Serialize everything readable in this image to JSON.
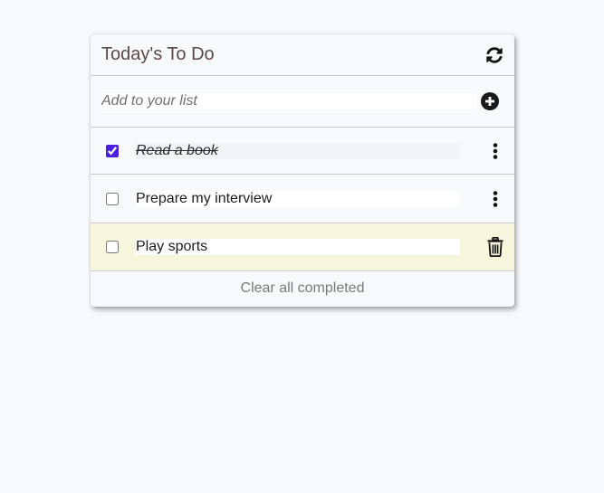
{
  "header": {
    "title": "Today's To Do",
    "refresh_icon": "refresh-icon"
  },
  "add": {
    "placeholder": "Add to your list",
    "value": "",
    "add_icon": "plus-circle-icon"
  },
  "items": [
    {
      "text": "Read a book",
      "completed": true,
      "action_icon": "vertical-dots-icon"
    },
    {
      "text": "Prepare my interview",
      "completed": false,
      "action_icon": "vertical-dots-icon"
    },
    {
      "text": "Play sports",
      "completed": false,
      "action_icon": "trash-icon",
      "highlighted": true
    }
  ],
  "footer": {
    "clear_label": "Clear all completed"
  },
  "colors": {
    "checkbox_accent": "#4b1fe0",
    "hover_row": "#f6f6dc",
    "title_text": "#5a4a4a"
  }
}
